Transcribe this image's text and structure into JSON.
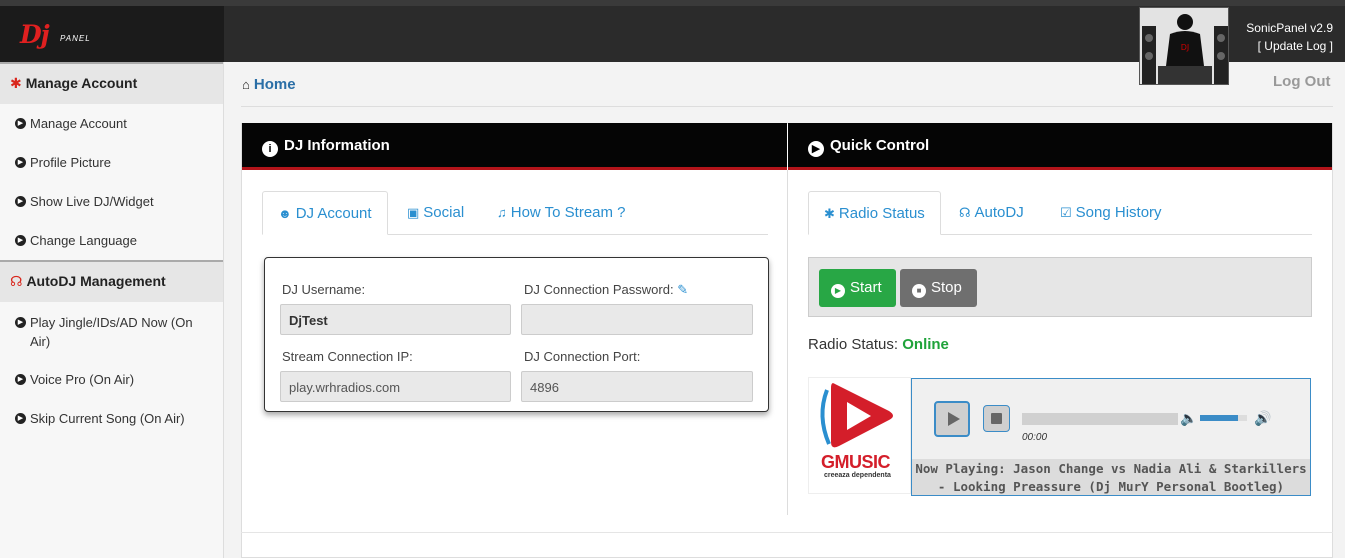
{
  "brand": {
    "logo_main": "Dj",
    "logo_sub": "PANEL",
    "app_version": "SonicPanel v2.9",
    "update_log": "[ Update Log ]"
  },
  "sidebar": {
    "sections": [
      {
        "title": "Manage Account",
        "icon": "gear-icon",
        "items": [
          {
            "label": "Manage Account"
          },
          {
            "label": "Profile Picture"
          },
          {
            "label": "Show Live DJ/Widget"
          },
          {
            "label": "Change Language"
          }
        ]
      },
      {
        "title": "AutoDJ Management",
        "icon": "headphones-icon",
        "items": [
          {
            "label": "Play Jingle/IDs/AD Now (On Air)"
          },
          {
            "label": "Voice Pro (On Air)"
          },
          {
            "label": "Skip Current Song (On Air)"
          }
        ]
      }
    ]
  },
  "header": {
    "breadcrumb": "Home",
    "logout": "Log Out"
  },
  "dj_panel": {
    "title": "DJ Information",
    "tabs": [
      {
        "label": "DJ Account",
        "icon": "user-circle-icon",
        "active": true
      },
      {
        "label": "Social",
        "icon": "facebook-icon",
        "active": false
      },
      {
        "label": "How To Stream ?",
        "icon": "music-note-icon",
        "active": false
      }
    ],
    "fields": {
      "username_label": "DJ Username:",
      "username_value": "DjTest",
      "password_label": "DJ Connection Password:",
      "password_value": "",
      "ip_label": "Stream Connection IP:",
      "ip_value": "play.wrhradios.com",
      "port_label": "DJ Connection Port:",
      "port_value": "4896"
    }
  },
  "quick_control": {
    "title": "Quick Control",
    "tabs": [
      {
        "label": "Radio Status",
        "icon": "gear-icon",
        "active": true
      },
      {
        "label": "AutoDJ",
        "icon": "headphones-icon",
        "active": false
      },
      {
        "label": "Song History",
        "icon": "calendar-check-icon",
        "active": false
      }
    ],
    "start_label": "Start",
    "stop_label": "Stop",
    "status_label": "Radio Status:",
    "status_value": "Online",
    "status_color": "#1fa33a"
  },
  "player": {
    "logo_text": "GMUSIC",
    "logo_tagline": "creeaza dependenta",
    "time": "00:00",
    "volume_level": 0.8,
    "now_playing": "Now Playing: Jason Change vs Nadia Ali & Starkillers - Looking Preassure (Dj MurY Personal Bootleg)"
  },
  "colors": {
    "accent_blue": "#2a8fd0",
    "panel_header": "#050505",
    "panel_header_border": "#b3141a",
    "start_green": "#28a745",
    "stop_gray": "#6f6f6f"
  }
}
